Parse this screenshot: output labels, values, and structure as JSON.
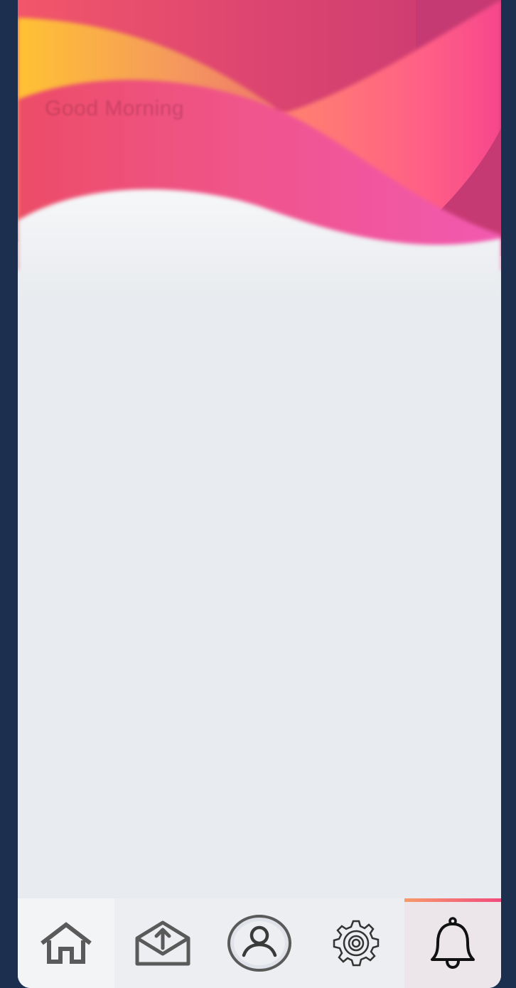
{
  "header": {
    "greeting": "Good Morning",
    "gradient_colors": [
      "#ffc233",
      "#f05a6a",
      "#d63d6e",
      "#ff7a6b",
      "#f24f8e",
      "#c93b7c"
    ]
  },
  "bottom_nav": {
    "items": [
      {
        "icon": "home-icon",
        "active": false
      },
      {
        "icon": "mail-upload-icon",
        "active": false
      },
      {
        "icon": "profile-icon",
        "active": false
      },
      {
        "icon": "gear-icon",
        "active": false
      },
      {
        "icon": "bell-icon",
        "active": true
      }
    ],
    "active_color": "#f14b7d"
  }
}
